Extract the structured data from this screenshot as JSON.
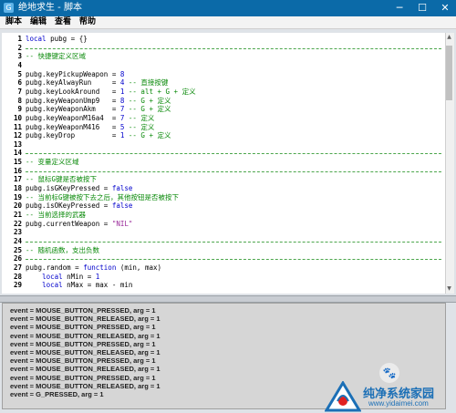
{
  "window": {
    "title": "绝地求生 - 脚本",
    "controls": {
      "minimize": "─",
      "maximize": "☐",
      "close": "✕"
    }
  },
  "menu": [
    {
      "label": "脚本"
    },
    {
      "label": "编辑"
    },
    {
      "label": "查看"
    },
    {
      "label": "帮助"
    }
  ],
  "editor": {
    "lines": [
      {
        "n": "1",
        "sep": false,
        "seg": [
          [
            "kw",
            "local"
          ],
          [
            "op",
            " pubg = {}"
          ]
        ]
      },
      {
        "n": "2",
        "sep": true,
        "seg": []
      },
      {
        "n": "3",
        "sep": false,
        "seg": [
          [
            "c",
            "-- 快捷键定义区域"
          ]
        ]
      },
      {
        "n": "4",
        "sep": false,
        "seg": []
      },
      {
        "n": "5",
        "sep": false,
        "seg": [
          [
            "op",
            "pubg.keyPickupWeapon = "
          ],
          [
            "num",
            "8"
          ]
        ]
      },
      {
        "n": "6",
        "sep": false,
        "seg": [
          [
            "op",
            "pubg.keyAlwayRun     = "
          ],
          [
            "num",
            "4"
          ],
          [
            "c",
            " -- 直接按键"
          ]
        ]
      },
      {
        "n": "7",
        "sep": false,
        "seg": [
          [
            "op",
            "pubg.keyLookAround   = "
          ],
          [
            "num",
            "1"
          ],
          [
            "c",
            " -- alt + G + 定义"
          ]
        ]
      },
      {
        "n": "8",
        "sep": false,
        "seg": [
          [
            "op",
            "pubg.keyWeaponUmp9   = "
          ],
          [
            "num",
            "8"
          ],
          [
            "c",
            " -- G + 定义"
          ]
        ]
      },
      {
        "n": "9",
        "sep": false,
        "seg": [
          [
            "op",
            "pubg.keyWeaponAkm    = "
          ],
          [
            "num",
            "7"
          ],
          [
            "c",
            " -- G + 定义"
          ]
        ]
      },
      {
        "n": "10",
        "sep": false,
        "seg": [
          [
            "op",
            "pubg.keyWeaponM16a4  = "
          ],
          [
            "num",
            "7"
          ],
          [
            "c",
            " -- 定义"
          ]
        ]
      },
      {
        "n": "11",
        "sep": false,
        "seg": [
          [
            "op",
            "pubg.keyWeaponM416   = "
          ],
          [
            "num",
            "5"
          ],
          [
            "c",
            " -- 定义"
          ]
        ]
      },
      {
        "n": "12",
        "sep": false,
        "seg": [
          [
            "op",
            "pubg.keyDrop         = "
          ],
          [
            "num",
            "1"
          ],
          [
            "c",
            " -- G + 定义"
          ]
        ]
      },
      {
        "n": "13",
        "sep": false,
        "seg": []
      },
      {
        "n": "14",
        "sep": true,
        "seg": []
      },
      {
        "n": "15",
        "sep": false,
        "seg": [
          [
            "c",
            "-- 变量定义区域"
          ]
        ]
      },
      {
        "n": "16",
        "sep": true,
        "seg": []
      },
      {
        "n": "17",
        "sep": false,
        "seg": [
          [
            "c",
            "-- 鼠标G键是否被按下"
          ]
        ]
      },
      {
        "n": "18",
        "sep": false,
        "seg": [
          [
            "op",
            "pubg.isGKeyPressed = "
          ],
          [
            "kw",
            "false"
          ]
        ]
      },
      {
        "n": "19",
        "sep": false,
        "seg": [
          [
            "c",
            "-- 当前标G键被按下去之后，其他按钮是否被按下"
          ]
        ]
      },
      {
        "n": "20",
        "sep": false,
        "seg": [
          [
            "op",
            "pubg.isOKeyPressed = "
          ],
          [
            "kw",
            "false"
          ]
        ]
      },
      {
        "n": "21",
        "sep": false,
        "seg": [
          [
            "c",
            "-- 当前选择的武器"
          ]
        ]
      },
      {
        "n": "22",
        "sep": false,
        "seg": [
          [
            "op",
            "pubg.currentWeapon = "
          ],
          [
            "s",
            "\"NIL\""
          ]
        ]
      },
      {
        "n": "23",
        "sep": false,
        "seg": []
      },
      {
        "n": "24",
        "sep": true,
        "seg": []
      },
      {
        "n": "25",
        "sep": false,
        "seg": [
          [
            "c",
            "-- 随机函数，支出负数"
          ]
        ]
      },
      {
        "n": "26",
        "sep": true,
        "seg": []
      },
      {
        "n": "27",
        "sep": false,
        "seg": [
          [
            "op",
            "pubg.random = "
          ],
          [
            "kw",
            "function"
          ],
          [
            "op",
            " (min, max)"
          ]
        ]
      },
      {
        "n": "28",
        "sep": false,
        "seg": [
          [
            "op",
            "    "
          ],
          [
            "kw",
            "local"
          ],
          [
            "op",
            " nMin = "
          ],
          [
            "num",
            "1"
          ]
        ]
      },
      {
        "n": "29",
        "sep": false,
        "seg": [
          [
            "op",
            "    "
          ],
          [
            "kw",
            "local"
          ],
          [
            "op",
            " nMax = max - min"
          ]
        ]
      }
    ]
  },
  "output": {
    "lines": [
      "event = MOUSE_BUTTON_PRESSED, arg = 1",
      "event = MOUSE_BUTTON_RELEASED, arg = 1",
      "event = MOUSE_BUTTON_PRESSED, arg = 1",
      "event = MOUSE_BUTTON_RELEASED, arg = 1",
      "event = MOUSE_BUTTON_PRESSED, arg = 1",
      "event = MOUSE_BUTTON_RELEASED, arg = 1",
      "event = MOUSE_BUTTON_PRESSED, arg = 1",
      "event = MOUSE_BUTTON_RELEASED, arg = 1",
      "event = MOUSE_BUTTON_PRESSED, arg = 1",
      "event = MOUSE_BUTTON_RELEASED, arg = 1",
      "event = G_PRESSED, arg = 1"
    ]
  },
  "watermark": {
    "name": "纯净系统家园",
    "url": "www.yidaimei.com"
  },
  "colors": {
    "titlebar": "#0b6aa8",
    "comment": "#0a8a0a",
    "keyword": "#0000cc",
    "string": "#9a2a9a"
  },
  "icons": {
    "app": "app-logo-icon",
    "scroll_up": "triangle-up-icon",
    "scroll_down": "triangle-down-icon",
    "watermark_paw": "paw-icon"
  }
}
